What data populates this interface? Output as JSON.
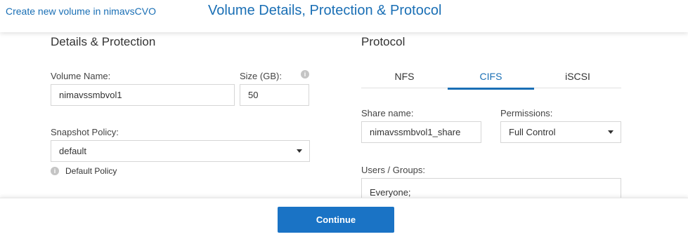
{
  "header": {
    "breadcrumb": "Create new volume in nimavsCVO",
    "title": "Volume Details, Protection & Protocol"
  },
  "details": {
    "section_title": "Details & Protection",
    "volume_name_label": "Volume Name:",
    "volume_name_value": "nimavssmbvol1",
    "size_label": "Size (GB):",
    "size_value": "50",
    "snapshot_label": "Snapshot Policy:",
    "snapshot_value": "default",
    "snapshot_note": "Default Policy"
  },
  "protocol": {
    "section_title": "Protocol",
    "tabs": [
      {
        "label": "NFS",
        "active": false
      },
      {
        "label": "CIFS",
        "active": true
      },
      {
        "label": "iSCSI",
        "active": false
      }
    ],
    "share_name_label": "Share name:",
    "share_name_value": "nimavssmbvol1_share",
    "permissions_label": "Permissions:",
    "permissions_value": "Full Control",
    "users_groups_label": "Users / Groups:",
    "users_groups_value": "Everyone;"
  },
  "footer": {
    "continue_label": "Continue"
  },
  "colors": {
    "accent": "#1a6fb5",
    "button": "#1a73c5"
  },
  "icons": {
    "info": "info-icon",
    "dropdown": "caret-down-icon"
  }
}
